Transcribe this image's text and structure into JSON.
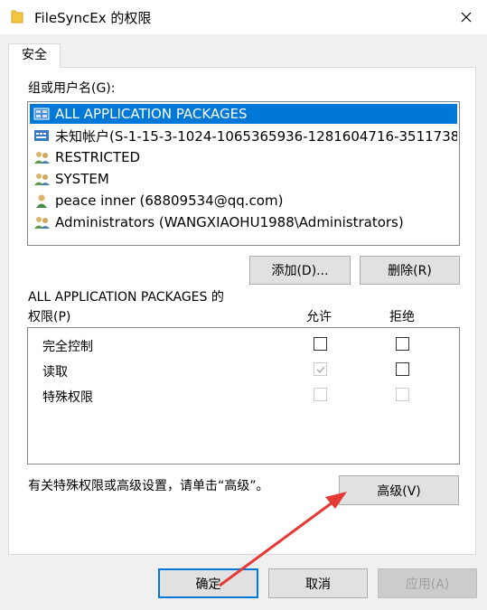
{
  "window": {
    "title": "FileSyncEx 的权限"
  },
  "tabs": [
    {
      "label": "安全"
    }
  ],
  "group_section": {
    "label": "组或用户名(G):",
    "items": [
      {
        "label": "ALL APPLICATION PACKAGES",
        "icon": "app-package-icon",
        "selected": true
      },
      {
        "label": "未知帐户(S-1-15-3-1024-1065365936-1281604716-3511738...",
        "icon": "unknown-account-icon",
        "selected": false
      },
      {
        "label": "RESTRICTED",
        "icon": "group-users-icon",
        "selected": false
      },
      {
        "label": "SYSTEM",
        "icon": "group-users-icon",
        "selected": false
      },
      {
        "label": "peace inner (68809534@qq.com)",
        "icon": "user-icon",
        "selected": false
      },
      {
        "label": "Administrators (WANGXIAOHU1988\\Administrators)",
        "icon": "group-users-icon",
        "selected": false
      }
    ],
    "add_button": "添加(D)...",
    "remove_button": "删除(R)"
  },
  "permissions": {
    "title_line1": "ALL APPLICATION PACKAGES 的",
    "title_line2": "权限(P)",
    "allow_header": "允许",
    "deny_header": "拒绝",
    "rows": [
      {
        "name": "完全控制",
        "allow": false,
        "allow_enabled": true,
        "deny": false,
        "deny_enabled": true
      },
      {
        "name": "读取",
        "allow": true,
        "allow_enabled": false,
        "deny": false,
        "deny_enabled": true
      },
      {
        "name": "特殊权限",
        "allow": false,
        "allow_enabled": false,
        "deny": false,
        "deny_enabled": false
      }
    ]
  },
  "advanced": {
    "hint": "有关特殊权限或高级设置，请单击“高级”。",
    "button": "高级(V)"
  },
  "footer": {
    "ok": "确定",
    "cancel": "取消",
    "apply": "应用(A)"
  },
  "colors": {
    "selection": "#0078d7",
    "annotation_arrow": "#e53935"
  }
}
